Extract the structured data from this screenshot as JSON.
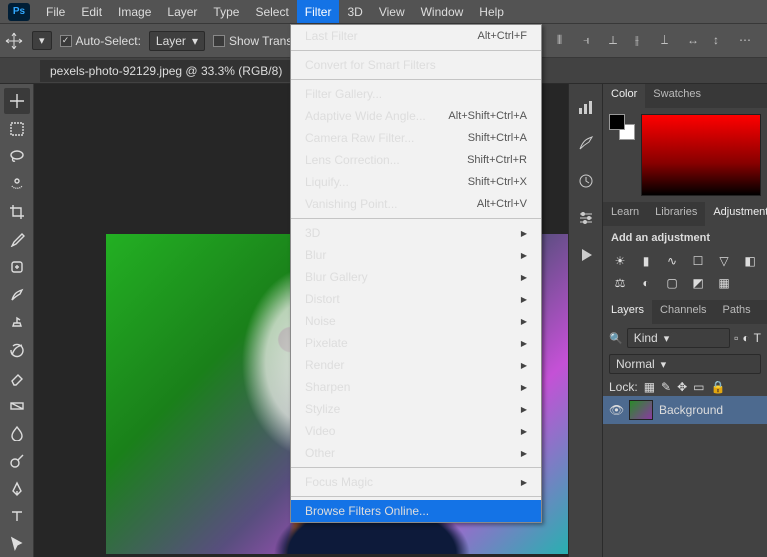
{
  "app": {
    "badge": "Ps"
  },
  "menubar": [
    "File",
    "Edit",
    "Image",
    "Layer",
    "Type",
    "Select",
    "Filter",
    "3D",
    "View",
    "Window",
    "Help"
  ],
  "menubar_open_index": 6,
  "options": {
    "auto_select_label": "Auto-Select:",
    "auto_select_checked": true,
    "layer_dd": "Layer",
    "show_transform_label": "Show Transform Controls",
    "show_transform_checked": false
  },
  "document": {
    "tab_label": "pexels-photo-92129.jpeg @ 33.3% (RGB/8)"
  },
  "filter_menu": {
    "items": [
      {
        "label": "Last Filter",
        "shortcut": "Alt+Ctrl+F"
      },
      {
        "div": true
      },
      {
        "label": "Convert for Smart Filters"
      },
      {
        "div": true
      },
      {
        "label": "Filter Gallery..."
      },
      {
        "label": "Adaptive Wide Angle...",
        "shortcut": "Alt+Shift+Ctrl+A"
      },
      {
        "label": "Camera Raw Filter...",
        "shortcut": "Shift+Ctrl+A"
      },
      {
        "label": "Lens Correction...",
        "shortcut": "Shift+Ctrl+R"
      },
      {
        "label": "Liquify...",
        "shortcut": "Shift+Ctrl+X"
      },
      {
        "label": "Vanishing Point...",
        "shortcut": "Alt+Ctrl+V"
      },
      {
        "div": true
      },
      {
        "label": "3D",
        "sub": true
      },
      {
        "label": "Blur",
        "sub": true
      },
      {
        "label": "Blur Gallery",
        "sub": true
      },
      {
        "label": "Distort",
        "sub": true
      },
      {
        "label": "Noise",
        "sub": true
      },
      {
        "label": "Pixelate",
        "sub": true
      },
      {
        "label": "Render",
        "sub": true
      },
      {
        "label": "Sharpen",
        "sub": true
      },
      {
        "label": "Stylize",
        "sub": true
      },
      {
        "label": "Video",
        "sub": true
      },
      {
        "label": "Other",
        "sub": true
      },
      {
        "div": true
      },
      {
        "label": "Focus Magic",
        "sub": true
      },
      {
        "div": true
      },
      {
        "label": "Browse Filters Online...",
        "highlight": true
      }
    ]
  },
  "panels": {
    "color_tabs": [
      "Color",
      "Swatches"
    ],
    "learn_tabs": [
      "Learn",
      "Libraries",
      "Adjustments"
    ],
    "adjustments_header": "Add an adjustment",
    "layers_tabs": [
      "Layers",
      "Channels",
      "Paths"
    ],
    "kind_label": "Kind",
    "blend_mode": "Normal",
    "lock_label": "Lock:",
    "layer0_name": "Background"
  }
}
